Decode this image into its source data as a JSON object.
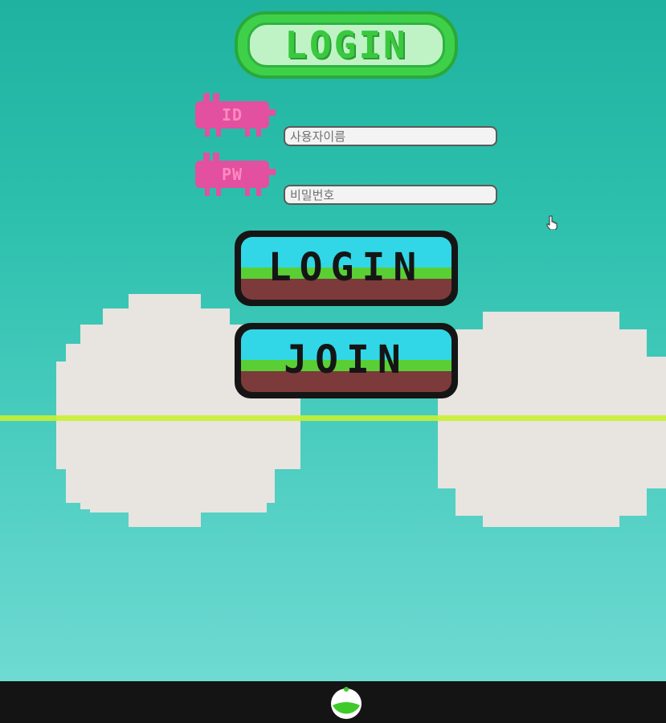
{
  "header": {
    "title": "LOGIN"
  },
  "form": {
    "id_label": "ID",
    "pw_label": "PW",
    "username_placeholder": "사용자이름",
    "password_placeholder": "비밀번호"
  },
  "actions": {
    "login_label": "LOGIN",
    "join_label": "JOIN"
  },
  "colors": {
    "sky": "#2cbfac",
    "title_green": "#3fd04a",
    "tag_pink": "#e2509f",
    "button_sky": "#31d7e6",
    "button_grass": "#59cf35",
    "button_dirt": "#7c3b3a",
    "horizon": "#c8f032",
    "cloud": "#e8e4e0"
  },
  "icons": {
    "cursor": "hand-pointer-icon",
    "dock_app": "green-app-icon"
  }
}
